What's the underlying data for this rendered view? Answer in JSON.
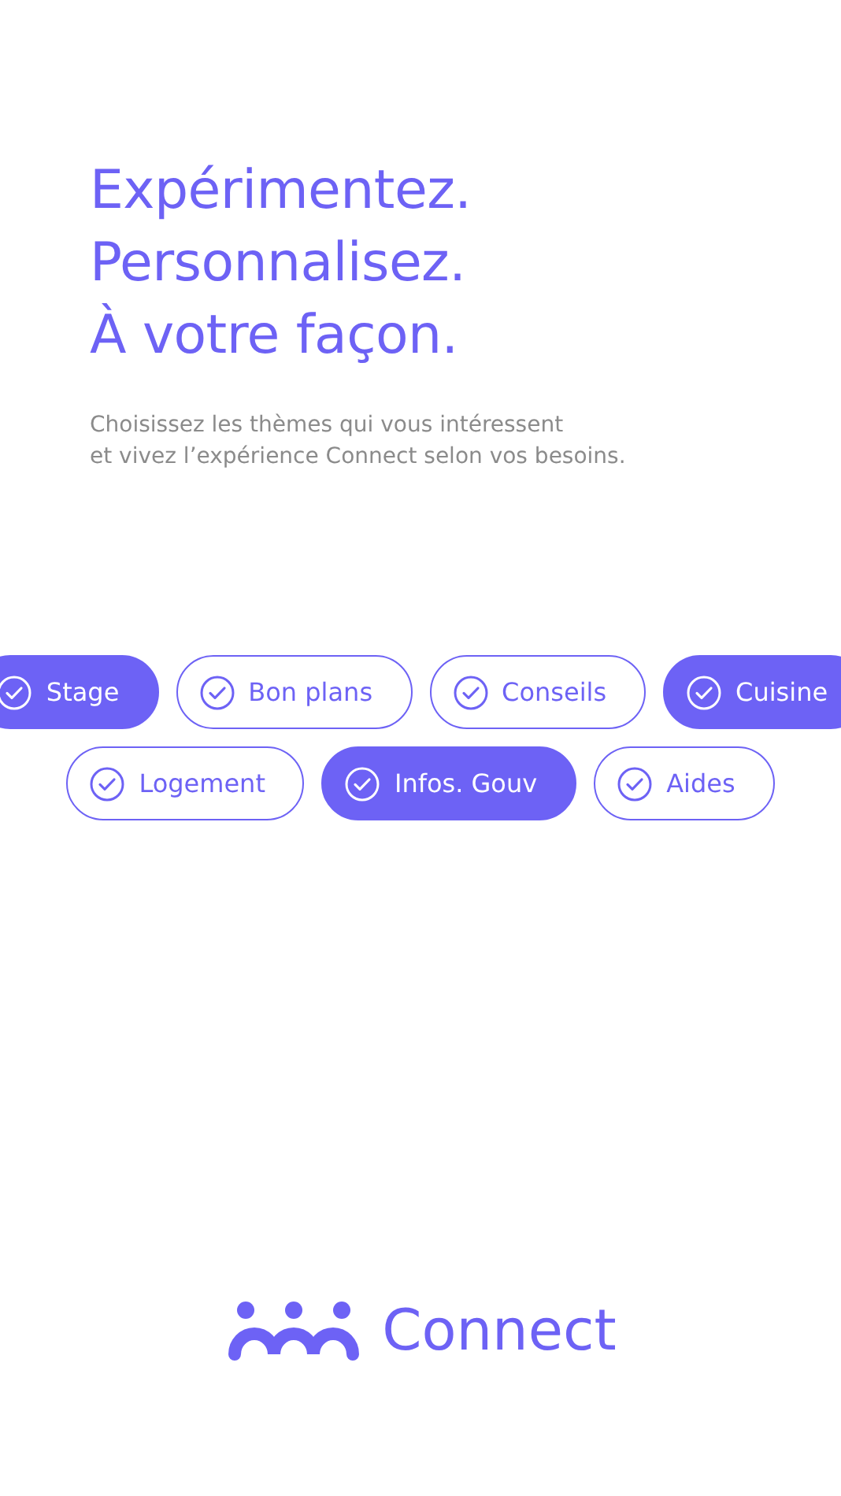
{
  "headline": [
    "Expérimentez.",
    "Personnalisez.",
    "À votre façon."
  ],
  "subtitle": [
    "Choisissez les thèmes qui vous intéressent",
    "et vivez l’expérience Connect selon vos besoins."
  ],
  "topic_rows": [
    [
      {
        "label": "Stage",
        "selected": true
      },
      {
        "label": "Bon plans",
        "selected": false
      },
      {
        "label": "Conseils",
        "selected": false
      },
      {
        "label": "Cuisine",
        "selected": true
      }
    ],
    [
      {
        "label": "Logement",
        "selected": false
      },
      {
        "label": "Infos. Gouv",
        "selected": true
      },
      {
        "label": "Aides",
        "selected": false
      }
    ]
  ],
  "brand": {
    "name": "Connect"
  }
}
